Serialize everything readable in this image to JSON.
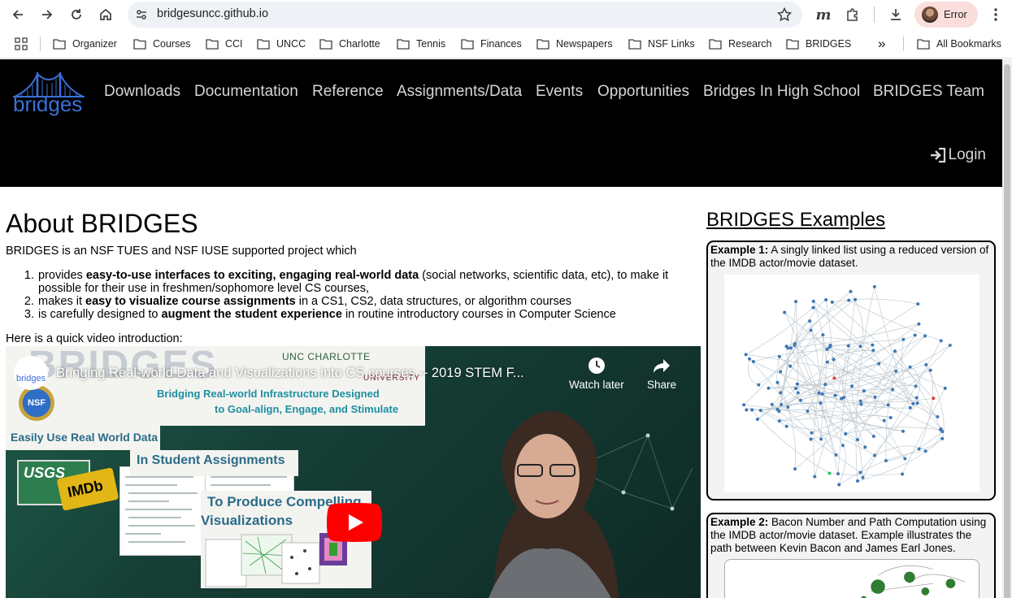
{
  "browser": {
    "url": "bridgesuncc.github.io",
    "profile_label": "Error",
    "bookmarks": [
      "Organizer",
      "Courses",
      "CCI",
      "UNCC",
      "Charlotte",
      "Tennis",
      "Finances",
      "Newspapers",
      "NSF Links",
      "Research",
      "BRIDGES"
    ],
    "all_bookmarks_label": "All Bookmarks",
    "overflow_label": "»"
  },
  "site": {
    "logo_text": "bridges",
    "nav": [
      "Downloads",
      "Documentation",
      "Reference",
      "Assignments/Data",
      "Events",
      "Opportunities",
      "Bridges In High School",
      "BRIDGES Team"
    ],
    "login_label": "Login",
    "colors": {
      "header_bg": "#000000",
      "logo_blue": "#3b6fd8",
      "accent_red": "#ff0000"
    }
  },
  "about": {
    "title": "About BRIDGES",
    "intro": "BRIDGES is an NSF TUES and NSF IUSE supported project which",
    "points": [
      {
        "num": "1.",
        "pre": "provides ",
        "bold": "easy-to-use interfaces to exciting, engaging real-world data",
        "post": " (social networks, scientific data, etc), to make it possible for their use in freshmen/sophomore level CS courses,"
      },
      {
        "num": "2.",
        "pre": "makes it ",
        "bold": "easy to visualize course assignments",
        "post": " in a CS1, CS2, data structures, or algorithm courses"
      },
      {
        "num": "3.",
        "pre": "is carefully designed to ",
        "bold": "augment the student experience",
        "post": " in routine introductory courses in Computer Science"
      }
    ],
    "video_intro": "Here is a quick video introduction:"
  },
  "video": {
    "title": "Bringing Real-world Data and Visualizations into CS courses -- 2019 STEM F...",
    "watch_later": "Watch later",
    "share": "Share",
    "avatar_label": "bridges",
    "slide": {
      "big_word": "BRIDGES",
      "uncc": "UNC CHARLOTTE",
      "university": "UNIVERSITY",
      "sub1": "Bridging Real-world Infrastructure Designed",
      "sub2": "to Goal-align, Engage, and Stimulate",
      "easily": "Easily Use Real World Data",
      "student": "In Student Assignments",
      "produce1": "To Produce Compelling",
      "produce2": "Visualizations",
      "usgs": "USGS",
      "imdb": "IMDb",
      "nsf": "NSF"
    }
  },
  "examples": {
    "title": "BRIDGES Examples",
    "items": [
      {
        "label": "Example 1:",
        "text": " A singly linked list using a reduced version of the IMDB actor/movie dataset."
      },
      {
        "label": "Example 2:",
        "text": " Bacon Number and Path Computation using the IMDB actor/movie dataset. Example illustrates the path between Kevin Bacon and James Earl Jones."
      }
    ]
  }
}
